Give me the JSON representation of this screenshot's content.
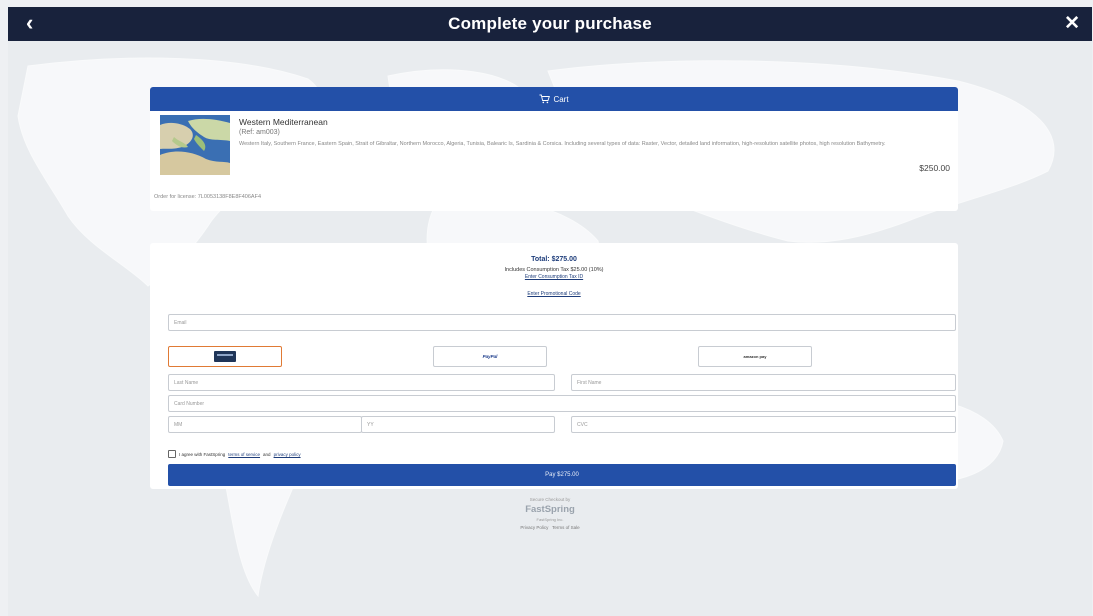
{
  "header": {
    "title": "Complete your purchase",
    "back_icon": "chevron-left-icon",
    "close_icon": "close-icon"
  },
  "cart": {
    "header_label": "Cart",
    "header_icon": "cart-icon",
    "product": {
      "name": "Western Mediterranean",
      "ref": "(Ref: am003)",
      "description": "Western Italy, Southern France, Eastern Spain, Strait of Gibraltar, Northern Morocco, Algeria, Tunisia, Balearic Is, Sardinia & Corsica. Including several types of data: Raster, Vector, detailed land information, high-resolution satellite photos, high resolution Bathymetry.",
      "price": "$250.00"
    },
    "license": "Order for license: 7L0053138F8E8F406AF4"
  },
  "checkout": {
    "total": "Total: $275.00",
    "tax": "Includes Consumption Tax $25.00 (10%)",
    "tax_id_link": "Enter Consumption Tax ID",
    "promo_link": "Enter Promotional Code",
    "email_placeholder": "Email",
    "payment_methods": [
      {
        "label": "Card",
        "icon": "credit-card-icon",
        "selected": true
      },
      {
        "label": "PayPal",
        "icon": "paypal-logo",
        "selected": false
      },
      {
        "label": "amazon pay",
        "icon": "amazon-pay-logo",
        "selected": false
      }
    ],
    "last_name_placeholder": "Last Name",
    "first_name_placeholder": "First Name",
    "card_number_placeholder": "Card Number",
    "month_placeholder": "MM",
    "year_placeholder": "YY",
    "cvc_placeholder": "CVC",
    "agree_prefix": "I agree with FastSpring",
    "terms_link": "terms of service",
    "agree_and": "and",
    "privacy_link": "privacy policy",
    "pay_button": "Pay $275.00"
  },
  "footer": {
    "powered": "Secure Checkout by",
    "brand": "FastSpring",
    "sub": "FastSpring Inc.",
    "privacy": "Privacy Policy",
    "terms": "Terms of Sale"
  },
  "colors": {
    "topbar": "#18223c",
    "accent": "#2350a8",
    "selected_border": "#e07a35"
  }
}
